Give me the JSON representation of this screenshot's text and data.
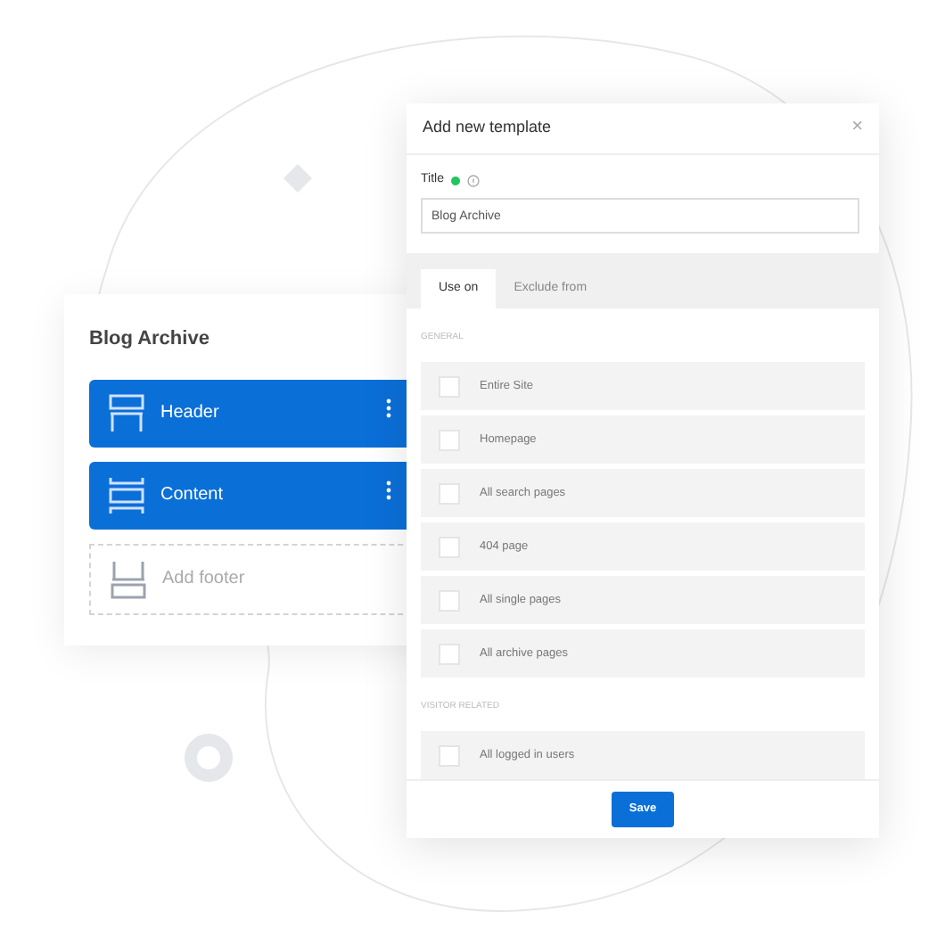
{
  "layout_card": {
    "title": "Blog Archive",
    "sections": [
      {
        "kind": "header",
        "label": "Header",
        "added": true
      },
      {
        "kind": "content",
        "label": "Content",
        "added": true
      },
      {
        "kind": "footer",
        "label": "Add footer",
        "added": false
      }
    ]
  },
  "dialog": {
    "title": "Add new template",
    "close": "×",
    "title_field": {
      "label": "Title",
      "value": "Blog Archive"
    },
    "tabs": [
      {
        "label": "Use on",
        "selected": true
      },
      {
        "label": "Exclude from",
        "selected": false
      }
    ],
    "groups": [
      {
        "heading": "GENERAL",
        "options": [
          {
            "label": "Entire Site",
            "checked": false
          },
          {
            "label": "Homepage",
            "checked": false
          },
          {
            "label": "All search pages",
            "checked": false
          },
          {
            "label": "404 page",
            "checked": false
          },
          {
            "label": "All single pages",
            "checked": false
          },
          {
            "label": "All archive pages",
            "checked": false
          }
        ]
      },
      {
        "heading": "VISITOR RELATED",
        "options": [
          {
            "label": "All logged in users",
            "checked": false
          }
        ]
      }
    ],
    "save": "Save"
  }
}
